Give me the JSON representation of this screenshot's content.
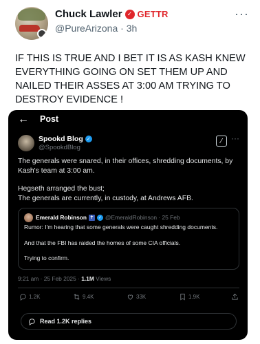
{
  "post": {
    "author": {
      "display_name": "Chuck Lawler",
      "platform_label": "GETTR",
      "handle": "@PureArizona",
      "time": "3h"
    },
    "text": "IF THIS IS TRUE AND I BET IT IS AS KASH KNEW EVERYTHING GOING ON SET THEM UP AND NAILED THEIR ASSES AT 3:00 AM TRYING TO DESTROY EVIDENCE !"
  },
  "screenshot": {
    "header_title": "Post",
    "author": {
      "display_name": "Spookd Blog",
      "handle": "@SpookdBlog"
    },
    "paragraphs": [
      "The generals were snared, in their offices, shredding documents, by Kash's team at 3:00 am.",
      "Hegseth arranged the bust;\nThe generals are currently, in custody, at Andrews AFB."
    ],
    "quote": {
      "display_name": "Emerald Robinson",
      "meta": "@EmeraldRobinson · 25 Feb",
      "paragraphs": [
        "Rumor: I'm hearing that some generals were caught shredding documents.",
        "And that the FBI has raided the homes of some CIA officials.",
        "Trying to confirm."
      ]
    },
    "timestamp": "9:21 am · 25 Feb 2025 · ",
    "views_count": "1.1M",
    "views_label": " Views",
    "actions": {
      "replies": "1.2K",
      "reposts": "9.4K",
      "likes": "33K",
      "bookmarks": "1.9K"
    },
    "read_replies_label": "Read 1.2K replies"
  },
  "colors": {
    "gettr_red": "#e0262b",
    "verified_blue": "#1d9bf0"
  }
}
